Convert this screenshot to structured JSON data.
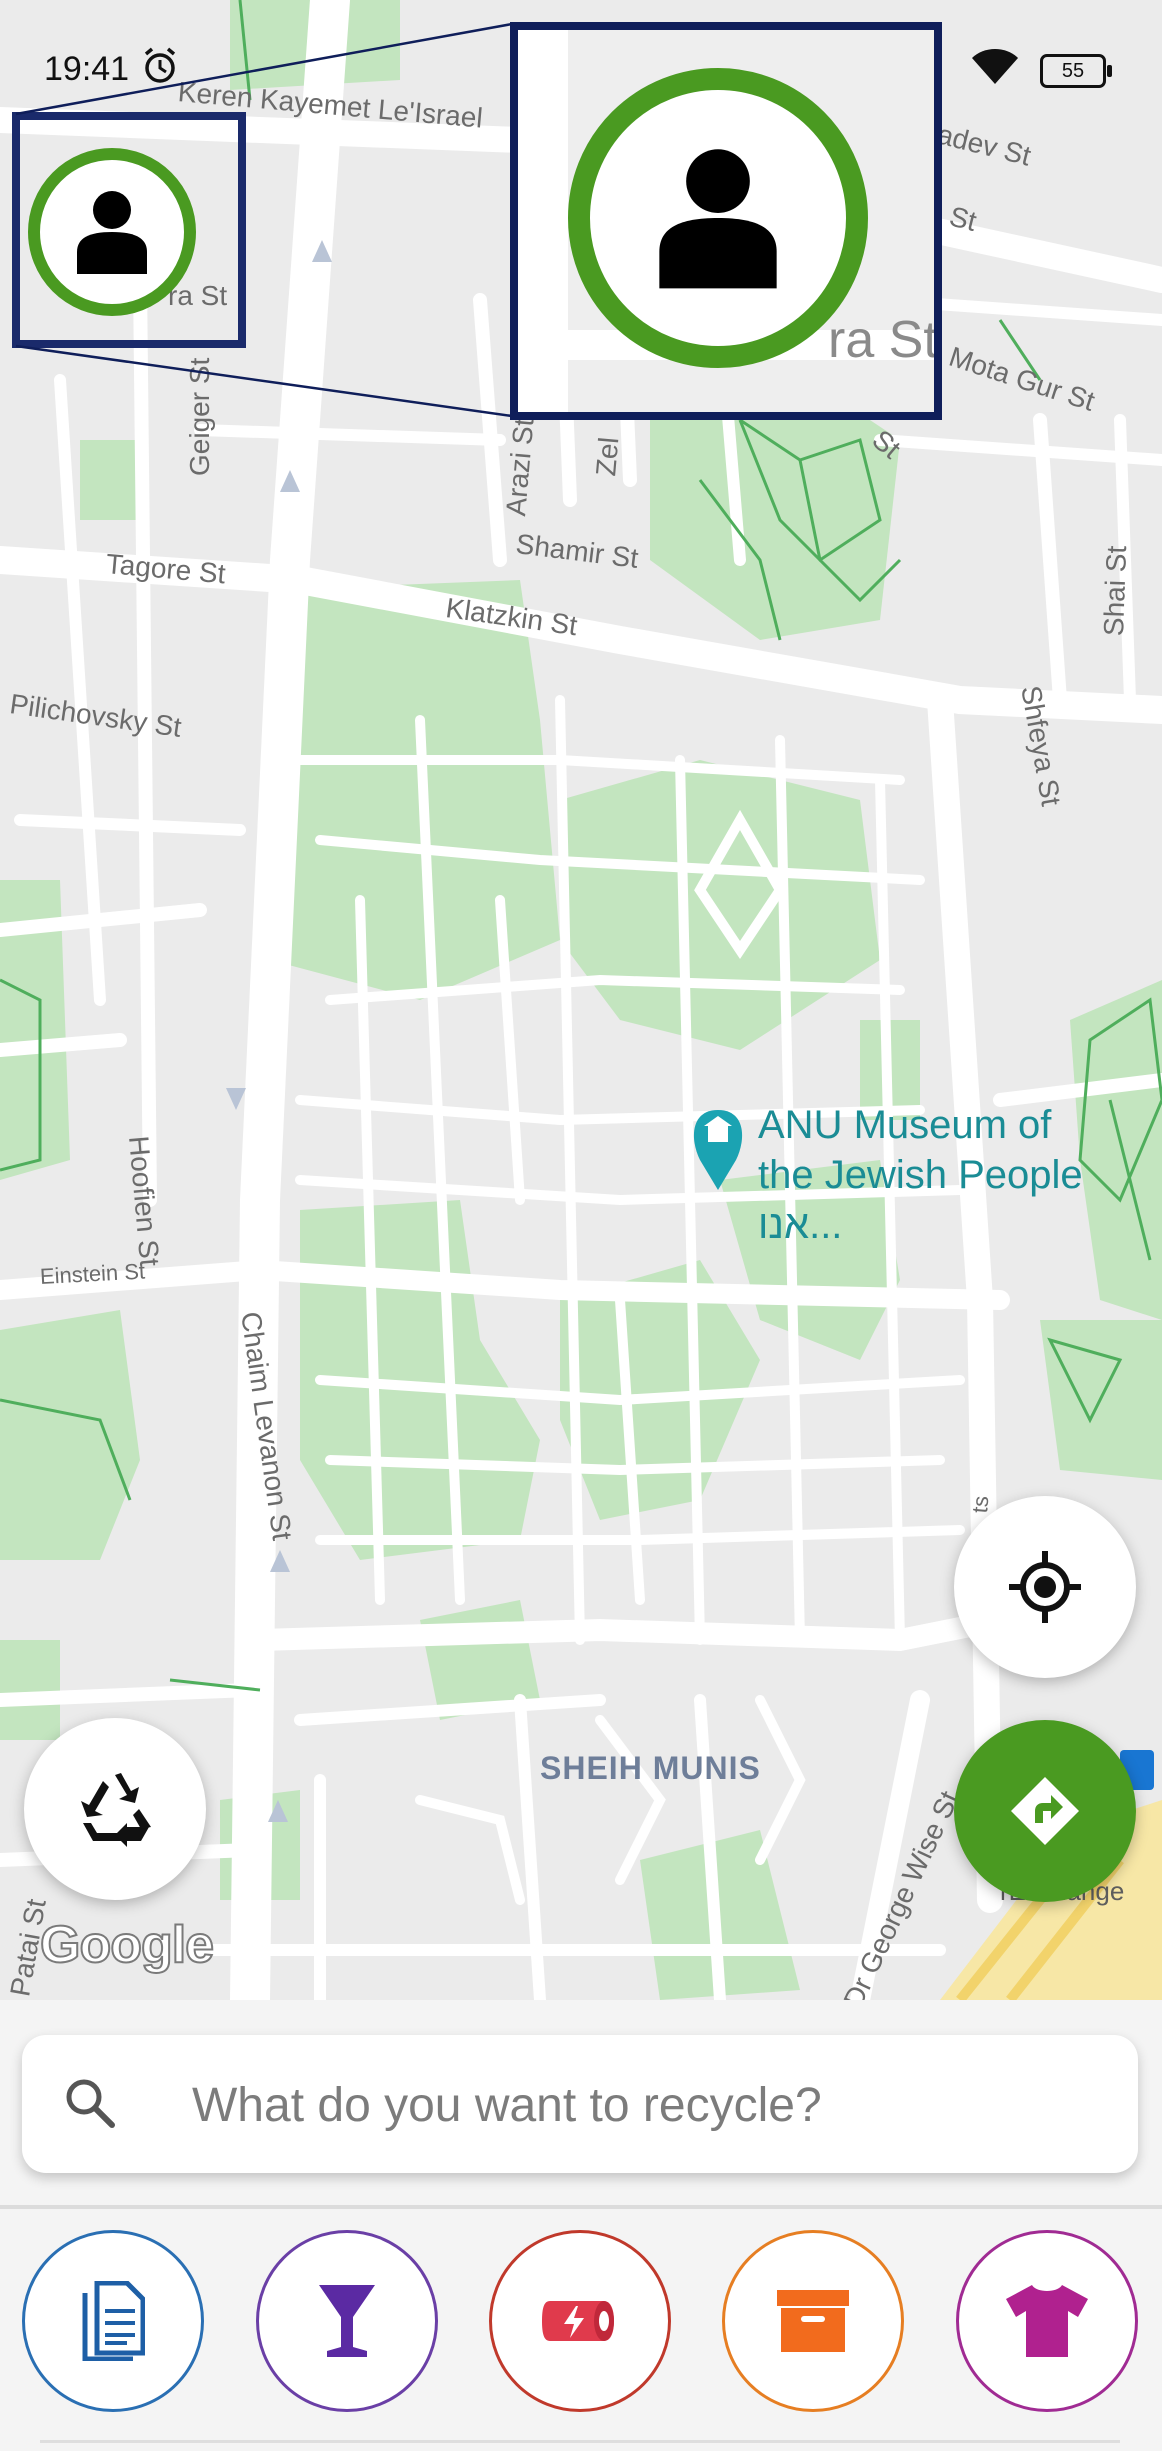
{
  "status_bar": {
    "time": "19:41",
    "battery": "55"
  },
  "map": {
    "streets": {
      "keren_kayemet": "Keren Kayemet Le'Israel",
      "adev": "adev St",
      "st_top_right": "St",
      "ra_st_small": "ra St",
      "ra_st_zoom": "ra St",
      "mota_gur": "Mota Gur St",
      "st_mid": "St",
      "geiger": "Geiger St",
      "arazi": "Arazi St",
      "zel": "Zel",
      "shamir": "Shamir St",
      "tagore": "Tagore St",
      "klatzkin": "Klatzkin St",
      "shfeya": "Shfeya St",
      "shai": "Shai St",
      "pilichovsky": "Pilichovsky St",
      "hoofien": "Hoofien St",
      "einstein": "Einstein St",
      "chaim_levanon": "Chaim Levanon St",
      "dr_george_wise": "Dr George Wise St",
      "patai": "Patai St",
      "exchange": "rExchange",
      "small_ts": "ts"
    },
    "poi": {
      "line1": "ANU Museum of",
      "line2": "the Jewish People אנו..."
    },
    "area": "SHEIH MUNIS",
    "google_logo": "Google"
  },
  "search": {
    "placeholder": "What do you want to recycle?"
  },
  "categories": [
    {
      "icon": "paper-icon",
      "color": "#2a6fb3"
    },
    {
      "icon": "glass-icon",
      "color": "#6a3fa6"
    },
    {
      "icon": "battery-icon",
      "color": "#c0392b"
    },
    {
      "icon": "carton-icon",
      "color": "#e67e22"
    },
    {
      "icon": "textile-icon",
      "color": "#a02b93"
    }
  ],
  "colors": {
    "brand_green": "#4a9a21",
    "highlight_navy": "#0f1e5a"
  }
}
